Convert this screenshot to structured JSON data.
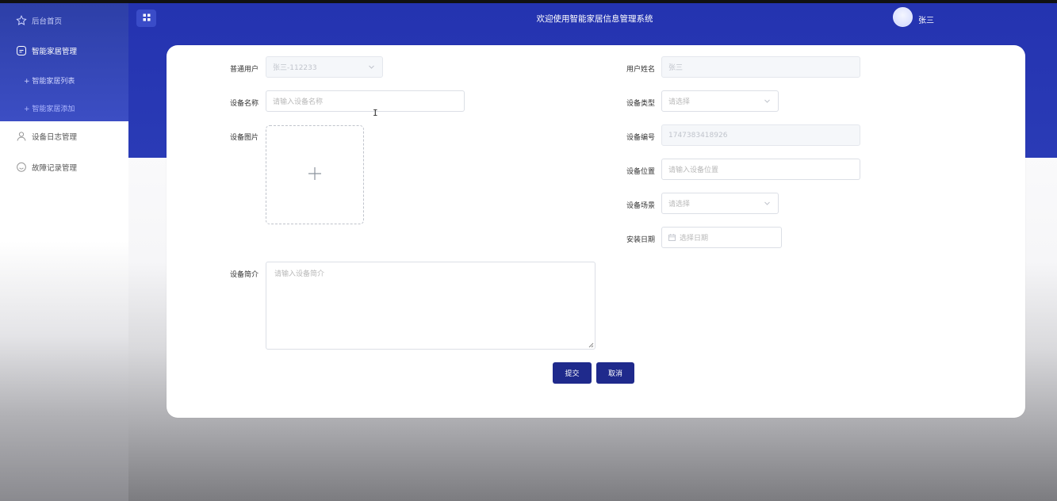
{
  "header": {
    "title": "欢迎使用智能家居信息管理系统",
    "user_name": "张三"
  },
  "sidebar": {
    "items": [
      {
        "label": "后台首页",
        "icon": "star-icon"
      },
      {
        "label": "智能家居管理",
        "icon": "device-icon"
      },
      {
        "label": "+ 智能家居列表"
      },
      {
        "label": "+ 智能家居添加"
      },
      {
        "label": "设备日志管理",
        "icon": "user-icon"
      },
      {
        "label": "故障记录管理",
        "icon": "chat-icon"
      }
    ]
  },
  "form": {
    "user": {
      "label": "普通用户",
      "value": "张三-112233"
    },
    "user_name": {
      "label": "用户姓名",
      "value": "张三"
    },
    "device_name": {
      "label": "设备名称",
      "placeholder": "请输入设备名称"
    },
    "device_type": {
      "label": "设备类型",
      "placeholder": "请选择"
    },
    "device_image": {
      "label": "设备图片"
    },
    "device_code": {
      "label": "设备编号",
      "value": "1747383418926"
    },
    "device_location": {
      "label": "设备位置",
      "placeholder": "请输入设备位置"
    },
    "device_scene": {
      "label": "设备场景",
      "placeholder": "请选择"
    },
    "install_date": {
      "label": "安装日期",
      "placeholder": "选择日期"
    },
    "device_intro": {
      "label": "设备简介",
      "placeholder": "请输入设备简介"
    }
  },
  "actions": {
    "submit": "提交",
    "cancel": "取消"
  },
  "colors": {
    "header_blue": "#2a3bb6",
    "sidebar_blue": "#3447b8",
    "button": "#1f2a8c"
  }
}
